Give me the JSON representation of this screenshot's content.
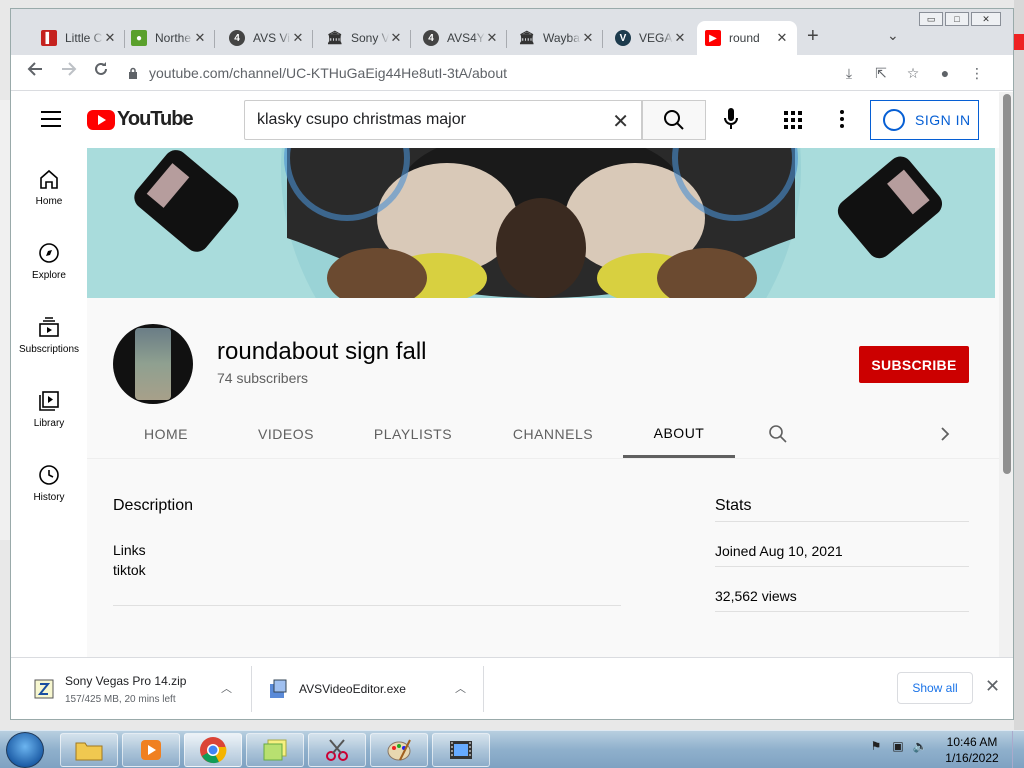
{
  "browser": {
    "tabs": [
      {
        "title": "Little C",
        "icon": "red-book-icon",
        "color": "#c5221f",
        "glyph": "▌"
      },
      {
        "title": "Northe",
        "icon": "green-leaf-icon",
        "color": "#5aa02c",
        "glyph": "●"
      },
      {
        "title": "AVS Vi",
        "icon": "avs-icon",
        "color": "#444444",
        "glyph": "4"
      },
      {
        "title": "Sony V",
        "icon": "archive-icon",
        "color": "#333333",
        "glyph": "🏛"
      },
      {
        "title": "AVS4Y",
        "icon": "avs-icon",
        "color": "#444444",
        "glyph": "4"
      },
      {
        "title": "Waybac",
        "icon": "archive-icon",
        "color": "#333333",
        "glyph": "🏛"
      },
      {
        "title": "VEGAS",
        "icon": "vegas-icon",
        "color": "#1d3b4d",
        "glyph": "V"
      },
      {
        "title": "round",
        "icon": "youtube-icon",
        "color": "#ff0000",
        "glyph": "▶"
      }
    ],
    "new_tab": "+",
    "url_host": "youtube.com",
    "url_path": "/channel/UC-KTHuGaEig44He8utI-3tA/about"
  },
  "youtube": {
    "search_value": "klasky csupo christmas major",
    "sign_in": "SIGN IN",
    "nav": [
      {
        "label": "Home",
        "icon": "home-icon"
      },
      {
        "label": "Explore",
        "icon": "compass-icon"
      },
      {
        "label": "Subscriptions",
        "icon": "subscriptions-icon"
      },
      {
        "label": "Library",
        "icon": "library-icon"
      },
      {
        "label": "History",
        "icon": "history-icon"
      }
    ],
    "channel": {
      "name": "roundabout sign fall",
      "subscribers": "74 subscribers",
      "subscribe": "SUBSCRIBE",
      "tabs": [
        "HOME",
        "VIDEOS",
        "PLAYLISTS",
        "CHANNELS",
        "ABOUT"
      ],
      "selected_tab": "ABOUT"
    },
    "about": {
      "description_heading": "Description",
      "links_heading": "Links",
      "link1": "tiktok",
      "stats_heading": "Stats",
      "joined": "Joined Aug 10, 2021",
      "views": "32,562 views"
    }
  },
  "downloads": {
    "items": [
      {
        "name": "Sony Vegas Pro 14.zip",
        "status": "157/425 MB, 20 mins left"
      },
      {
        "name": "AVSVideoEditor.exe",
        "status": ""
      }
    ],
    "show_all": "Show all"
  },
  "taskbar": {
    "time": "10:46 AM",
    "date": "1/16/2022"
  }
}
